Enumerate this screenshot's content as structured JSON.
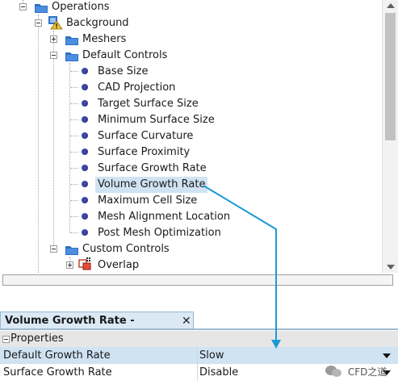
{
  "tree": {
    "items": [
      {
        "label": "Operations",
        "icon": "folder-icon"
      },
      {
        "label": "Background",
        "icon": "warning-operation-icon"
      },
      {
        "label": "Meshers",
        "icon": "folder-icon"
      },
      {
        "label": "Default Controls",
        "icon": "folder-icon"
      },
      {
        "label": "Base Size",
        "icon": "bullet-icon"
      },
      {
        "label": "CAD Projection",
        "icon": "bullet-icon"
      },
      {
        "label": "Target Surface Size",
        "icon": "bullet-icon"
      },
      {
        "label": "Minimum Surface Size",
        "icon": "bullet-icon"
      },
      {
        "label": "Surface Curvature",
        "icon": "bullet-icon"
      },
      {
        "label": "Surface Proximity",
        "icon": "bullet-icon"
      },
      {
        "label": "Surface Growth Rate",
        "icon": "bullet-icon"
      },
      {
        "label": "Volume Growth Rate",
        "icon": "bullet-icon",
        "selected": true
      },
      {
        "label": "Maximum Cell Size",
        "icon": "bullet-icon"
      },
      {
        "label": "Mesh Alignment Location",
        "icon": "bullet-icon"
      },
      {
        "label": "Post Mesh Optimization",
        "icon": "bullet-icon"
      },
      {
        "label": "Custom Controls",
        "icon": "folder-icon"
      },
      {
        "label": "Overlap",
        "icon": "overlap-control-icon"
      }
    ]
  },
  "panel": {
    "title": "Volume Growth Rate - Properties",
    "close": "✕",
    "group": "Properties",
    "rows": [
      {
        "name": "Default Growth Rate",
        "value": "Slow",
        "selected": true
      },
      {
        "name": "Surface Growth Rate",
        "value": "Disable"
      }
    ]
  },
  "watermark": "CFD之道",
  "colors": {
    "selection": "#cfe3f3",
    "accent_arrow": "#1b9ad6",
    "bullet": "#3b48a8",
    "folder": "#2f6fc4"
  }
}
